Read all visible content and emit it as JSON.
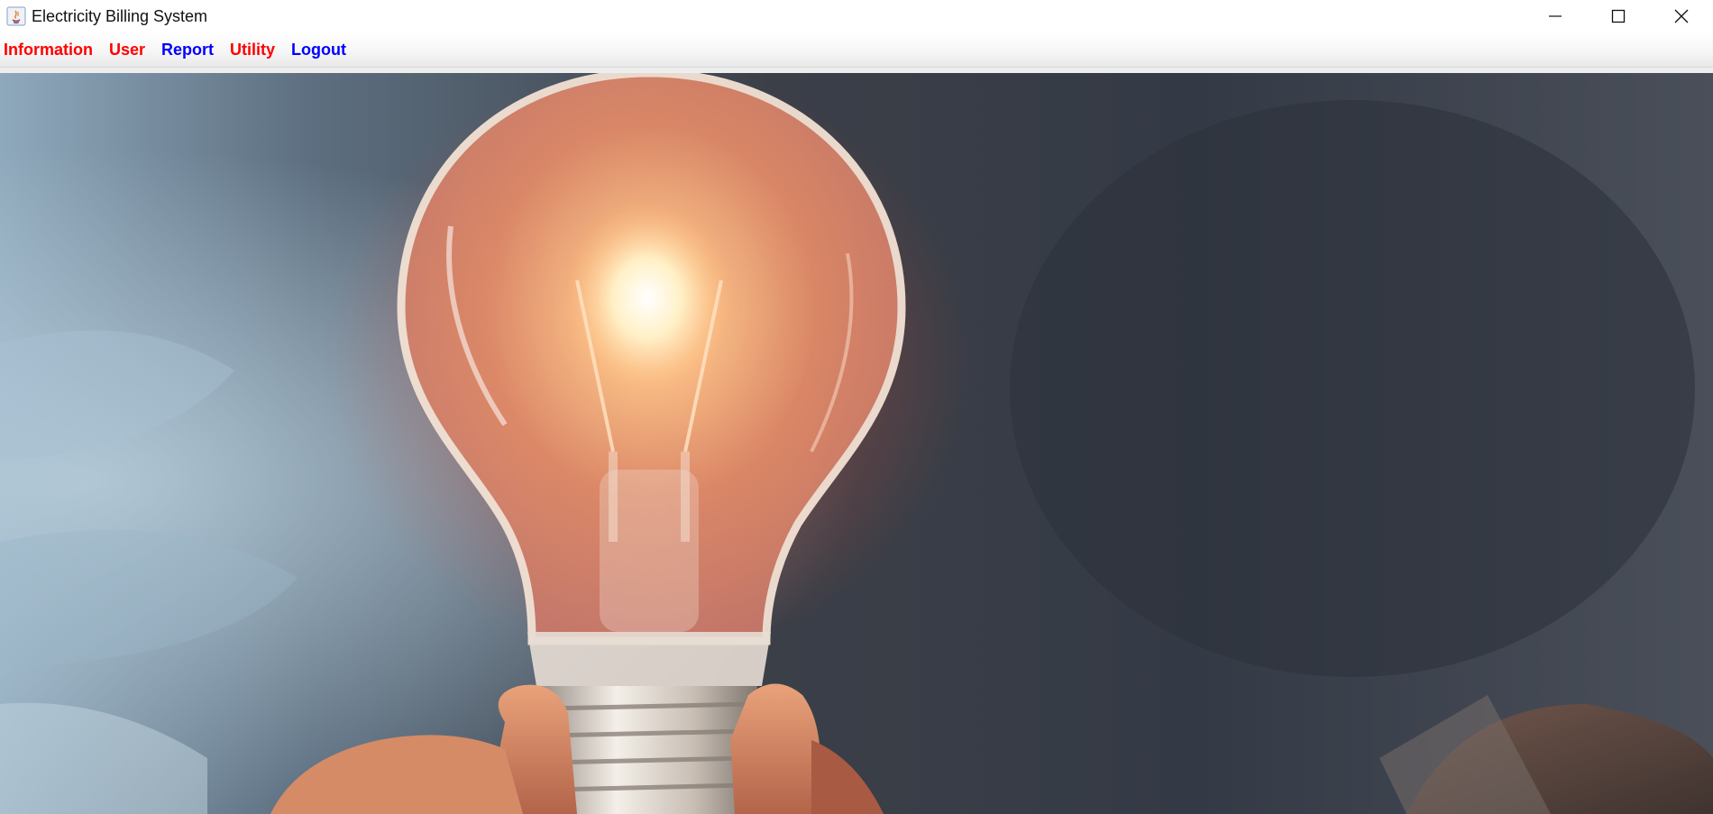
{
  "window": {
    "title": "Electricity Billing System",
    "icon": "java-app-icon",
    "controls": [
      "minimize-icon",
      "maximize-icon",
      "close-icon"
    ]
  },
  "menu": {
    "items": [
      {
        "label": "Information",
        "color": "#ff0000"
      },
      {
        "label": "User",
        "color": "#ff0000"
      },
      {
        "label": "Report",
        "color": "#0000ff"
      },
      {
        "label": "Utility",
        "color": "#ff0000"
      },
      {
        "label": "Logout",
        "color": "#0000ff"
      }
    ]
  },
  "content": {
    "image": "glowing-light-bulb-in-hand"
  }
}
